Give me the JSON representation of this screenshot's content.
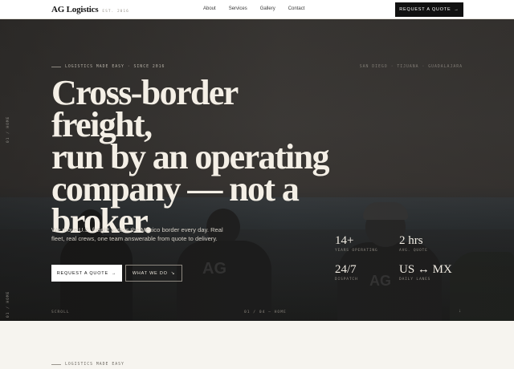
{
  "nav": {
    "brand": "AG Logistics",
    "est": "EST. 2016",
    "links": [
      "About",
      "Services",
      "Gallery",
      "Contact"
    ],
    "cta": "REQUEST A QUOTE",
    "cta_arrow": "→"
  },
  "hero": {
    "side_label_top": "01 / HOME",
    "side_label_bottom": "01 / HOME",
    "eyebrow": "LOGISTICS MADE EASY · SINCE 2016",
    "cities": "SAN DIEGO · TIJUANA · GUADALAJARA",
    "headline": [
      "Cross-border freight,",
      "run by an operating",
      "company — not a",
      "broker."
    ],
    "lede": "We move U.S. freight across the Mexico border every day. Real fleet, real crews, one team answerable from quote to delivery.",
    "primary_cta": "REQUEST A QUOTE",
    "primary_arrow": "→",
    "secondary_cta": "WHAT WE DO",
    "secondary_arrow": "↘",
    "stats": [
      {
        "value": "14+",
        "label": "YEARS OPERATING"
      },
      {
        "value": "2 hrs",
        "label": "AVG. QUOTE"
      },
      {
        "value": "24/7",
        "label": "DISPATCH"
      },
      {
        "value": "US ↔ MX",
        "label": "DAILY LANES"
      }
    ],
    "scroll": "SCROLL",
    "pager": "01 / 04 — HOME",
    "down_arrow": "↓",
    "logo_text": "AG"
  },
  "section": {
    "eyebrow": "LOGISTICS MADE EASY"
  },
  "colors": {
    "accent_dark": "#111111",
    "hero_text": "#f4efe6",
    "page_bg": "#f6f4ef"
  }
}
